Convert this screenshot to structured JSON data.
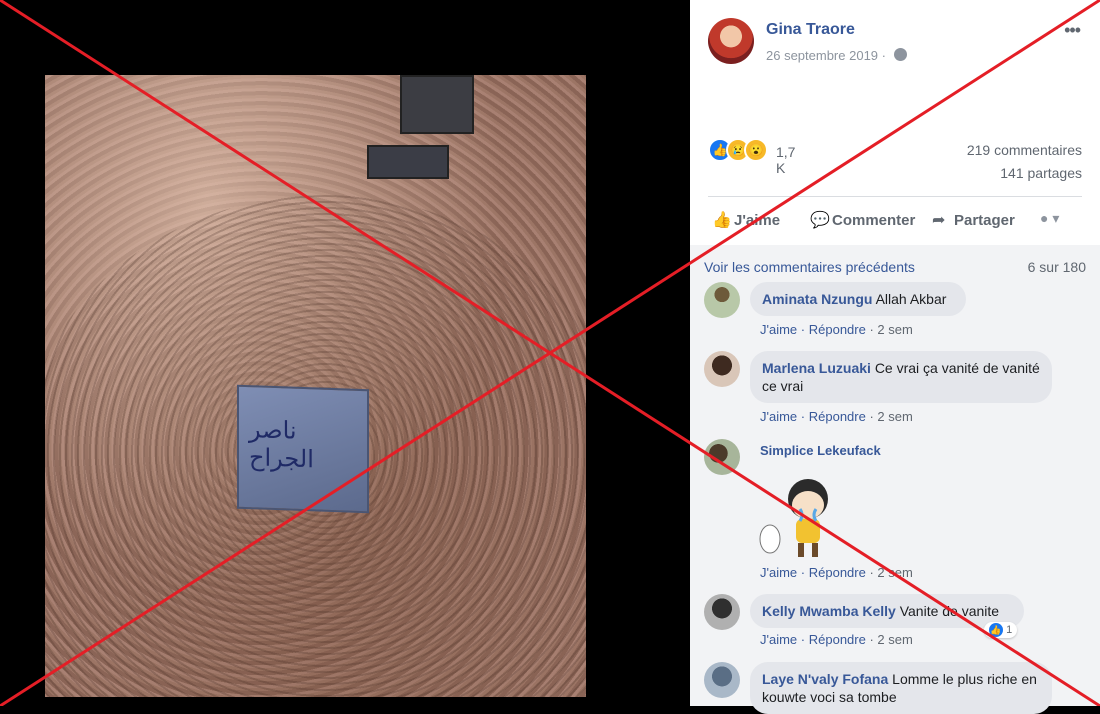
{
  "post": {
    "author": "Gina Traore",
    "date": "26 septembre 2019 ·",
    "more": "•••",
    "photo_inscription": "ناصر الجراح",
    "reactions_count": "1,7 K",
    "comments_count": "219 commentaires",
    "shares_count": "141 partages"
  },
  "actions": {
    "like": "J'aime",
    "comment": "Commenter",
    "share": "Partager"
  },
  "comments": {
    "prev_link": "Voir les commentaires précédents",
    "prev_count": "6 sur 180",
    "items": [
      {
        "name": "Aminata Nzungu",
        "text": "Allah Akbar",
        "like": "J'aime",
        "reply": "Répondre",
        "time": "· 2 sem"
      },
      {
        "name": "Marlena Luzuaki",
        "text": "Ce vrai ça vanité de vanité ce vrai",
        "like": "J'aime",
        "reply": "Répondre",
        "time": "· 2 sem"
      },
      {
        "name": "Simplice Lekeufack",
        "text": "",
        "like": "J'aime",
        "reply": "Répondre",
        "time": "· 2 sem"
      },
      {
        "name": "Kelly Mwamba Kelly",
        "text": "Vanite de vanite",
        "like": "J'aime",
        "reply": "Répondre",
        "time": "· 2 sem",
        "likes": "1"
      },
      {
        "name": "Laye N'valy Fofana",
        "text": "Lomme le plus riche en kouwte voci sa tombe"
      }
    ]
  },
  "colors": {
    "link": "#385898",
    "cross": "#e41e26",
    "like_blue": "#1877f2"
  }
}
